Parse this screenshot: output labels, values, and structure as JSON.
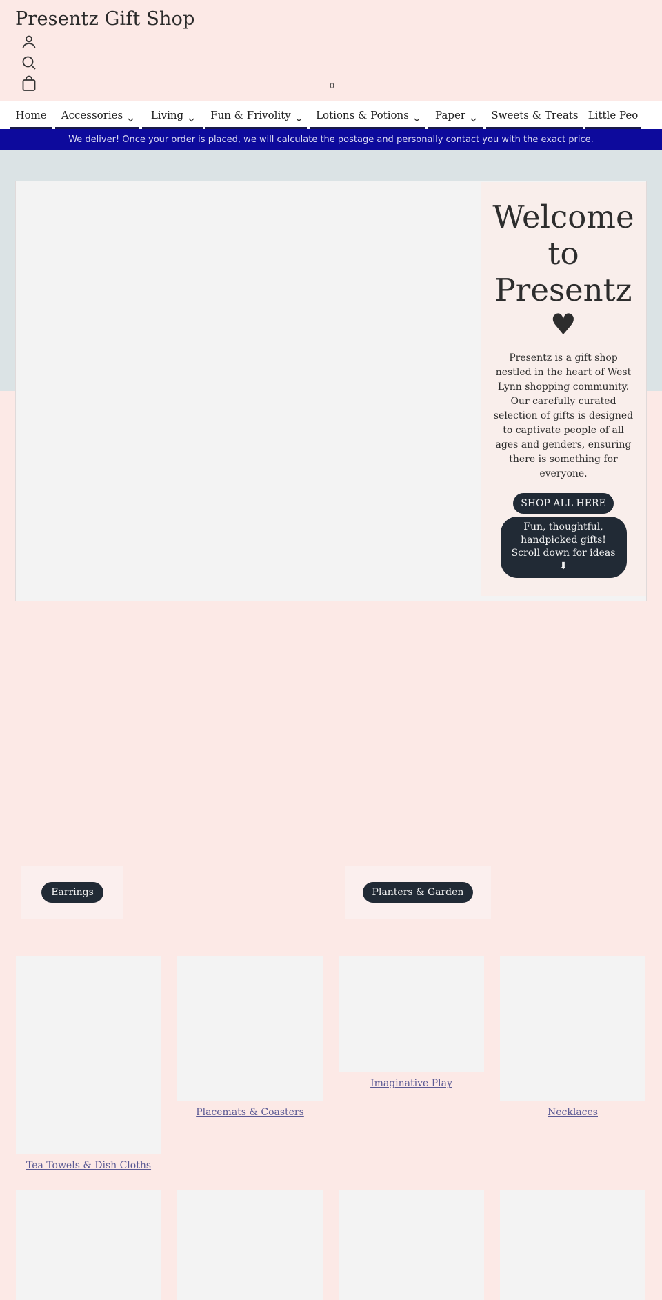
{
  "header": {
    "site_title": "Presentz Gift Shop",
    "icons": [
      "account-icon",
      "search-icon",
      "cart-icon"
    ],
    "cart_count": "0"
  },
  "nav": {
    "items": [
      {
        "label": "Home",
        "has_dropdown": false
      },
      {
        "label": "Accessories",
        "has_dropdown": true
      },
      {
        "label": "Living",
        "has_dropdown": true
      },
      {
        "label": "Fun & Frivolity",
        "has_dropdown": true
      },
      {
        "label": "Lotions & Potions",
        "has_dropdown": true
      },
      {
        "label": "Paper",
        "has_dropdown": true
      },
      {
        "label": "Sweets & Treats",
        "has_dropdown": false
      },
      {
        "label": "Little Peo",
        "has_dropdown": false
      }
    ]
  },
  "announcement": {
    "text": "We deliver! Once your order is placed, we will calculate the postage and personally contact you with the exact price."
  },
  "hero": {
    "heading": "Welcome to Presentz",
    "heart": "♥",
    "intro": "Presentz is a gift shop nestled in the heart of West Lynn shopping community. Our carefully curated selection of gifts is designed to captivate people of all ages and genders, ensuring there is something for everyone.",
    "shop_all_label": "SHOP ALL HERE",
    "scroll_label": "Fun, thoughtful, handpicked gifts! Scroll down for ideas",
    "scroll_arrow": "⬇"
  },
  "collections": [
    {
      "label": "Earrings"
    },
    {
      "label": "Planters & Garden"
    }
  ],
  "grid": {
    "row1": [
      {
        "label": "Tea Towels & Dish Cloths"
      },
      {
        "label": "Placemats & Coasters"
      },
      {
        "label": "Imaginative Play"
      },
      {
        "label": "Necklaces"
      }
    ]
  },
  "colors": {
    "page_bg": "#fce9e6",
    "announcement_bg": "#0d0a9c",
    "button_bg": "#212a35",
    "link": "#5b5a94"
  }
}
